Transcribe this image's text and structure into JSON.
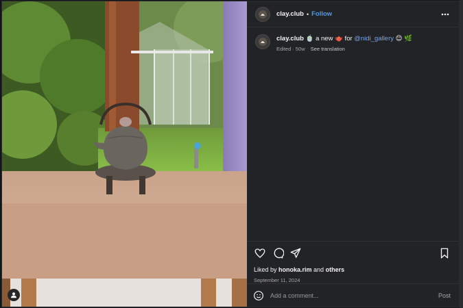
{
  "post": {
    "author": "clay.club",
    "separator": "•",
    "follow_label": "Follow",
    "more_icon": "more-horizontal-icon",
    "caption": {
      "username": "clay.club",
      "emoji_pre": "🍵",
      "text": "a new ",
      "emoji_mid": "🫖",
      "text2": " for ",
      "mention": "@nidi_gallery",
      "emoji_post": "😊 🌿"
    },
    "meta": {
      "edited": "Edited · 50w",
      "translation": "See translation"
    },
    "liked_by": {
      "prefix": "Liked by ",
      "user": "honoka.rim",
      "middle": " and ",
      "others": "others"
    },
    "date": "September 11, 2024",
    "comment_placeholder": "Add a comment...",
    "post_label": "Post"
  },
  "colors": {
    "accent": "#4a9bf0",
    "mention": "#7aa5e6",
    "panel_bg": "#222326"
  }
}
